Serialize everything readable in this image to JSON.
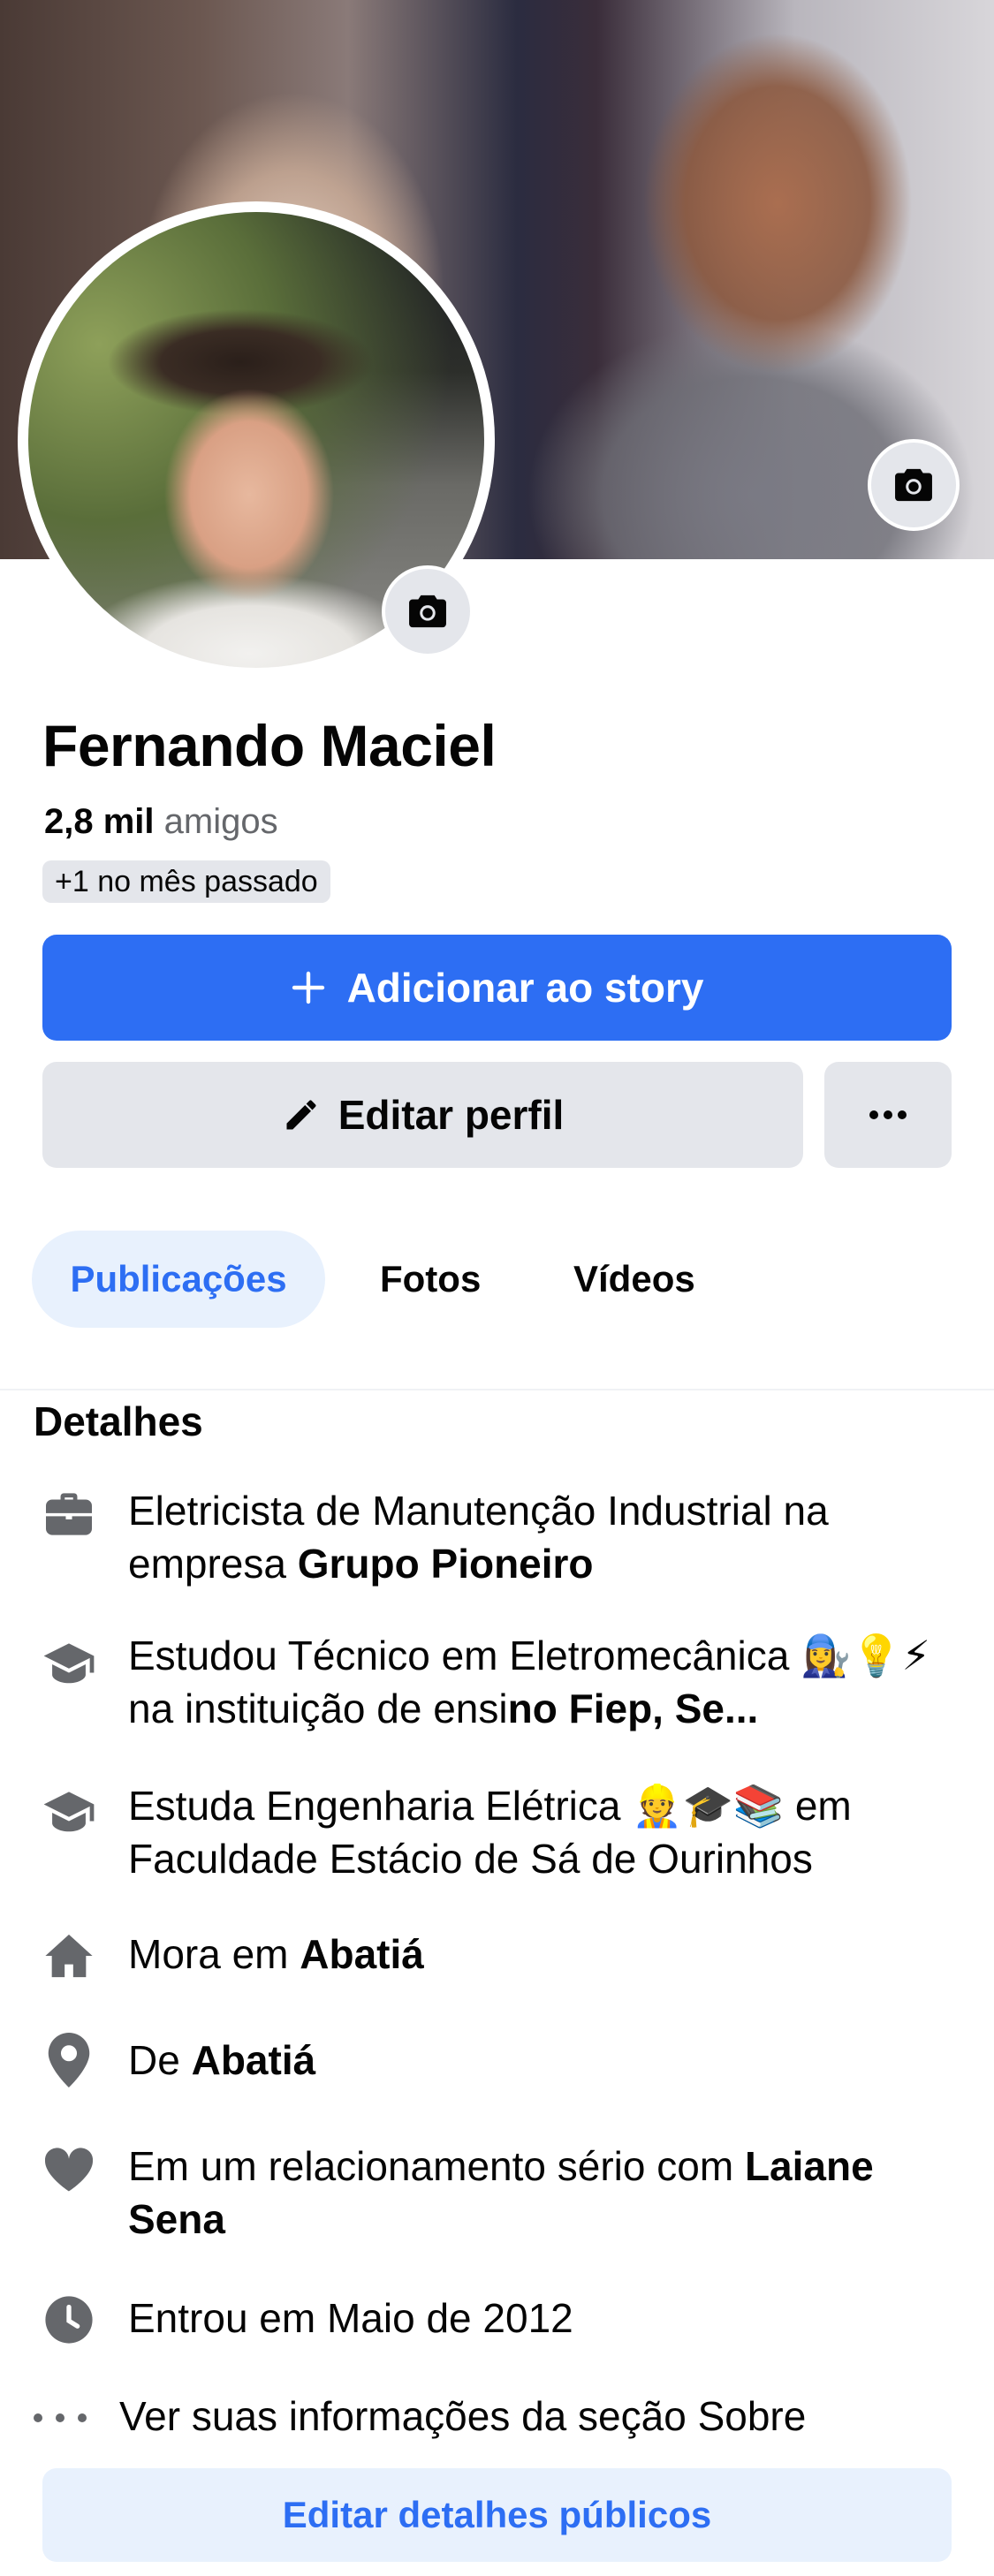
{
  "profile": {
    "name": "Fernando Maciel",
    "friends_count": "2,8 mil",
    "friends_label": "amigos",
    "friends_delta": "+1 no mês passado"
  },
  "actions": {
    "add_story_label": "Adicionar ao story",
    "edit_profile_label": "Editar perfil",
    "more_label": "•••"
  },
  "tabs": [
    {
      "label": "Publicações",
      "active": true
    },
    {
      "label": "Fotos",
      "active": false
    },
    {
      "label": "Vídeos",
      "active": false
    }
  ],
  "details": {
    "title": "Detalhes",
    "work_prefix": "Eletricista de Manutenção Industrial na empresa ",
    "work_company": "Grupo Pioneiro",
    "studied_prefix": "Estudou Técnico em Eletromecânica 👩‍🔧💡⚡ na instituição de ensi",
    "studied_school": "no Fiep, Se...",
    "studies_prefix": "Estuda Engenharia Elétrica 👷🎓📚 em Faculdade Estácio de Sá de Ourinhos",
    "lives_prefix": "Mora em ",
    "lives_city": "Abatiá",
    "from_prefix": "De ",
    "from_city": "Abatiá",
    "relationship_prefix": "Em um relacionamento sério com ",
    "relationship_partner": "Laiane Sena",
    "joined": "Entrou em Maio de 2012",
    "see_about": "Ver suas informações da seção Sobre",
    "edit_public_label": "Editar detalhes públicos"
  },
  "colors": {
    "accent": "#2d6ef3",
    "button_gray": "#e4e6eb",
    "icon_gray": "#65676b",
    "tab_active_bg": "#e8f1fd"
  },
  "icons": [
    "camera-icon",
    "plus-icon",
    "pencil-icon",
    "more-icon",
    "briefcase-icon",
    "graduation-cap-icon",
    "home-icon",
    "location-pin-icon",
    "heart-icon",
    "clock-icon",
    "dots-icon"
  ]
}
